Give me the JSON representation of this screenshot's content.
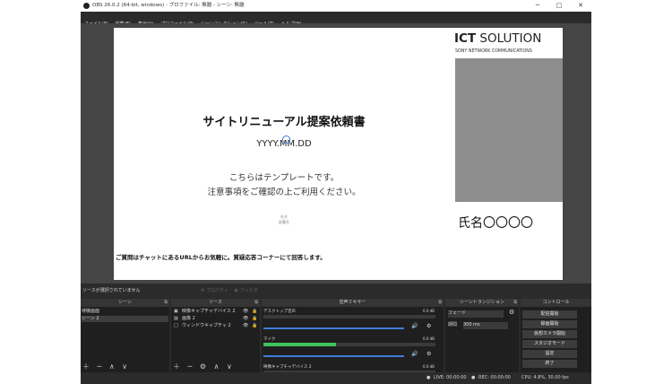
{
  "window": {
    "title": "OBS 26.0.2 (64-bit, windows) - プロファイル: 無題 - シーン: 無題",
    "controls": [
      "─",
      "□",
      "✕"
    ]
  },
  "menu": [
    "ファイル(F)",
    "編集(E)",
    "表示(V)",
    "プロファイル(P)",
    "シーンコレクション(S)",
    "ツール(T)",
    "ヘルプ(H)"
  ],
  "slide": {
    "title": "サイトリニューアル提案依頼書",
    "date": "YYYY.MM.DD",
    "note1": "こちらはテンプレートです。",
    "note2": "注意事項をご確認の上ご利用ください。",
    "small1": "社名",
    "small2": "部署名",
    "qa": "ご質問はチャットにあるURLからお気軽に。質疑応答コーナーにて回答します。",
    "brand_bold": "ICT",
    "brand_rest": " SOLUTION",
    "brand_sub": "SONY NETWORK COMMUNICATIONS",
    "name": "氏名〇〇〇〇"
  },
  "source_bar": {
    "message": "ソースが選択されていません",
    "properties": "⚙ プロパティ",
    "filters": "◐ フィルタ"
  },
  "scenes": {
    "header": "シーン",
    "items": [
      "待機画面",
      "シーン 2"
    ],
    "tools": "＋ ─ ∧ ∨"
  },
  "sources": {
    "header": "ソース",
    "items": [
      "映像キャプチャデバイス 2",
      "画像 2",
      "ウィンドウキャプチャ 2"
    ],
    "tools": "＋ ─ ⚙ ∧ ∨"
  },
  "mixer": {
    "header": "音声ミキサー",
    "tracks": [
      {
        "name": "デスクトップ音声",
        "db": "0.0 dB",
        "level": 0.0
      },
      {
        "name": "マイク",
        "db": "0.0 dB",
        "level": 0.42
      },
      {
        "name": "映像キャプチャデバイス 2",
        "db": "0.0 dB",
        "level": 0.0
      }
    ]
  },
  "transitions": {
    "header": "シーントランジション",
    "type": "フェード",
    "duration_label": "期間",
    "duration": "300 ms"
  },
  "controls": {
    "header": "コントロール",
    "buttons": [
      "配信開始",
      "録画開始",
      "仮想カメラ開始",
      "スタジオモード",
      "設定",
      "終了"
    ]
  },
  "status": {
    "live": "LIVE: 00:00:00",
    "rec": "REC: 00:00:00",
    "cpu": "CPU: 4.8%, 30.00 fps"
  },
  "colors": {
    "accent_blue": "#3f7dd8",
    "meter_green": "#3ec45a",
    "panel_dark": "#1f1f1f"
  }
}
